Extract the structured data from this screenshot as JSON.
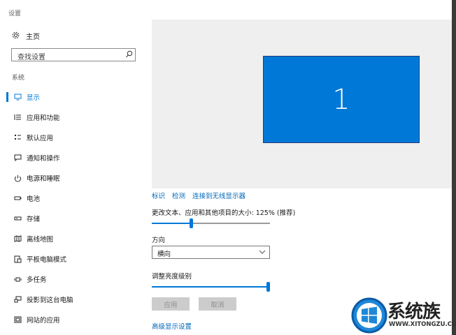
{
  "window": {
    "title": "设置"
  },
  "sidebar": {
    "home_label": "主页",
    "search_placeholder": "查找设置",
    "section_label": "系统",
    "items": [
      {
        "label": "显示",
        "icon": "monitor-icon",
        "active": true
      },
      {
        "label": "应用和功能",
        "icon": "apps-list-icon"
      },
      {
        "label": "默认应用",
        "icon": "default-apps-icon"
      },
      {
        "label": "通知和操作",
        "icon": "notification-icon"
      },
      {
        "label": "电源和睡眠",
        "icon": "power-icon"
      },
      {
        "label": "电池",
        "icon": "battery-icon"
      },
      {
        "label": "存储",
        "icon": "storage-icon"
      },
      {
        "label": "离线地图",
        "icon": "map-icon"
      },
      {
        "label": "平板电脑模式",
        "icon": "tablet-icon"
      },
      {
        "label": "多任务",
        "icon": "multitask-icon"
      },
      {
        "label": "投影到这台电脑",
        "icon": "project-icon"
      },
      {
        "label": "网站的应用",
        "icon": "web-apps-icon"
      }
    ]
  },
  "main": {
    "monitor_number": "1",
    "links": {
      "identify": "标识",
      "detect": "检测",
      "wireless": "连接到无线显示器"
    },
    "scale_label": "更改文本、应用和其他项目的大小: 125% (推荐)",
    "scale_slider_fraction": 0.33,
    "orientation_label": "方向",
    "orientation_value": "横向",
    "brightness_label": "调整亮度级别",
    "brightness_fraction": 1.0,
    "apply_label": "应用",
    "cancel_label": "取消",
    "advanced_link": "高级显示设置"
  },
  "watermark": {
    "text": "系统族",
    "url": "WWW.XITONGZU.COM"
  },
  "colors": {
    "accent": "#0078d7",
    "link": "#0067b8",
    "preview_bg": "#efefef"
  }
}
